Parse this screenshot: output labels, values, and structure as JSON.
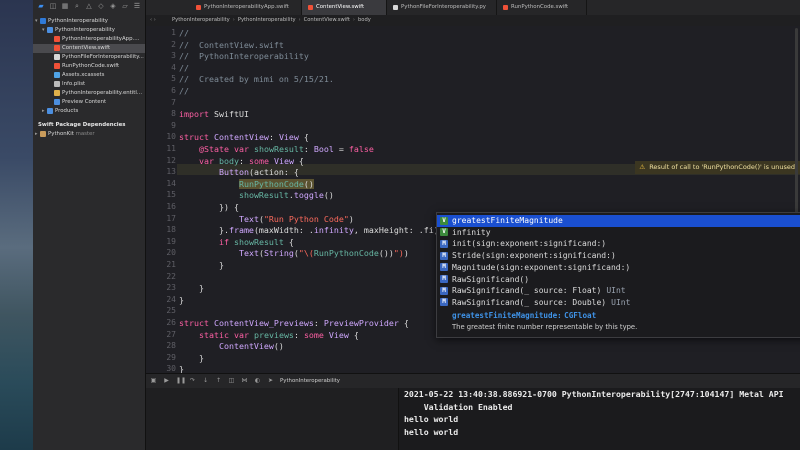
{
  "navigator": {
    "project_name": "PythonInteroperability",
    "group_name": "PythonInteroperability",
    "files": [
      {
        "label": "PythonInteroperabilityApp....",
        "type": "swift"
      },
      {
        "label": "ContentView.swift",
        "type": "swift",
        "selected": true
      },
      {
        "label": "PythonFileForInteroperability...",
        "type": "py"
      },
      {
        "label": "RunPythonCode.swift",
        "type": "swift"
      },
      {
        "label": "Assets.xcassets",
        "type": "assets"
      },
      {
        "label": "Info.plist",
        "type": "plist"
      },
      {
        "label": "PythonInteroperability.entitl...",
        "type": "ent"
      },
      {
        "label": "Preview Content",
        "type": "folder"
      }
    ],
    "products_label": "Products",
    "packages_header": "Swift Package Dependencies",
    "package_name": "PythonKit",
    "package_branch": "master"
  },
  "tabs": [
    {
      "label": "PythonInteroperabilityApp.swift",
      "type": "swift"
    },
    {
      "label": "ContentView.swift",
      "type": "swift",
      "active": true
    },
    {
      "label": "PythonFileForInteroperability.py",
      "type": "py"
    },
    {
      "label": "RunPythonCode.swift",
      "type": "swift"
    }
  ],
  "jumpbar": [
    "PythonInteroperability",
    "PythonInteroperability",
    "ContentView.swift",
    "body"
  ],
  "editor": {
    "line_numbers": [
      "1",
      "2",
      "3",
      "4",
      "5",
      "6",
      "7",
      "8",
      "9",
      "10",
      "11",
      "12",
      "13",
      "14",
      "15",
      "16",
      "17",
      "18",
      "19",
      "20",
      "21",
      "22",
      "23",
      "24",
      "25",
      "26",
      "27",
      "28",
      "29",
      "30"
    ],
    "comment_lines": [
      "//",
      "//  ContentView.swift",
      "//  PythonInteroperability",
      "//",
      "//  Created by mimi on 5/15/21.",
      "//"
    ],
    "import_kw": "import",
    "import_mod": "SwiftUI",
    "warning": "Result of call to 'RunPythonCode()' is unused"
  },
  "autocomplete": {
    "items": [
      {
        "badge": "V",
        "text": "greatestFiniteMagnitude",
        "ret": "",
        "selected": true
      },
      {
        "badge": "V",
        "text": "infinity",
        "ret": ""
      },
      {
        "badge": "M",
        "text": "init(sign:exponent:significand:)",
        "ret": ""
      },
      {
        "badge": "M",
        "text": "Stride(sign:exponent:significand:)",
        "ret": ""
      },
      {
        "badge": "M",
        "text": "Magnitude(sign:exponent:significand:)",
        "ret": ""
      },
      {
        "badge": "M",
        "text": "RawSignificand()",
        "ret": ""
      },
      {
        "badge": "M",
        "text": "RawSignificand(_ source: Float)",
        "ret": "UInt"
      },
      {
        "badge": "M",
        "text": "RawSignificand(_ source: Double)",
        "ret": "UInt"
      }
    ],
    "detail_name": "greatestFiniteMagnitude:",
    "detail_type": "CGFloat",
    "description": "The greatest finite number representable by this type."
  },
  "debug": {
    "process_name": "PythonInteroperability",
    "console_lines": [
      "2021-05-22 13:40:38.886921-0700 PythonInteroperability[2747:104147] Metal API",
      "    Validation Enabled",
      "hello world",
      "hello world"
    ]
  }
}
